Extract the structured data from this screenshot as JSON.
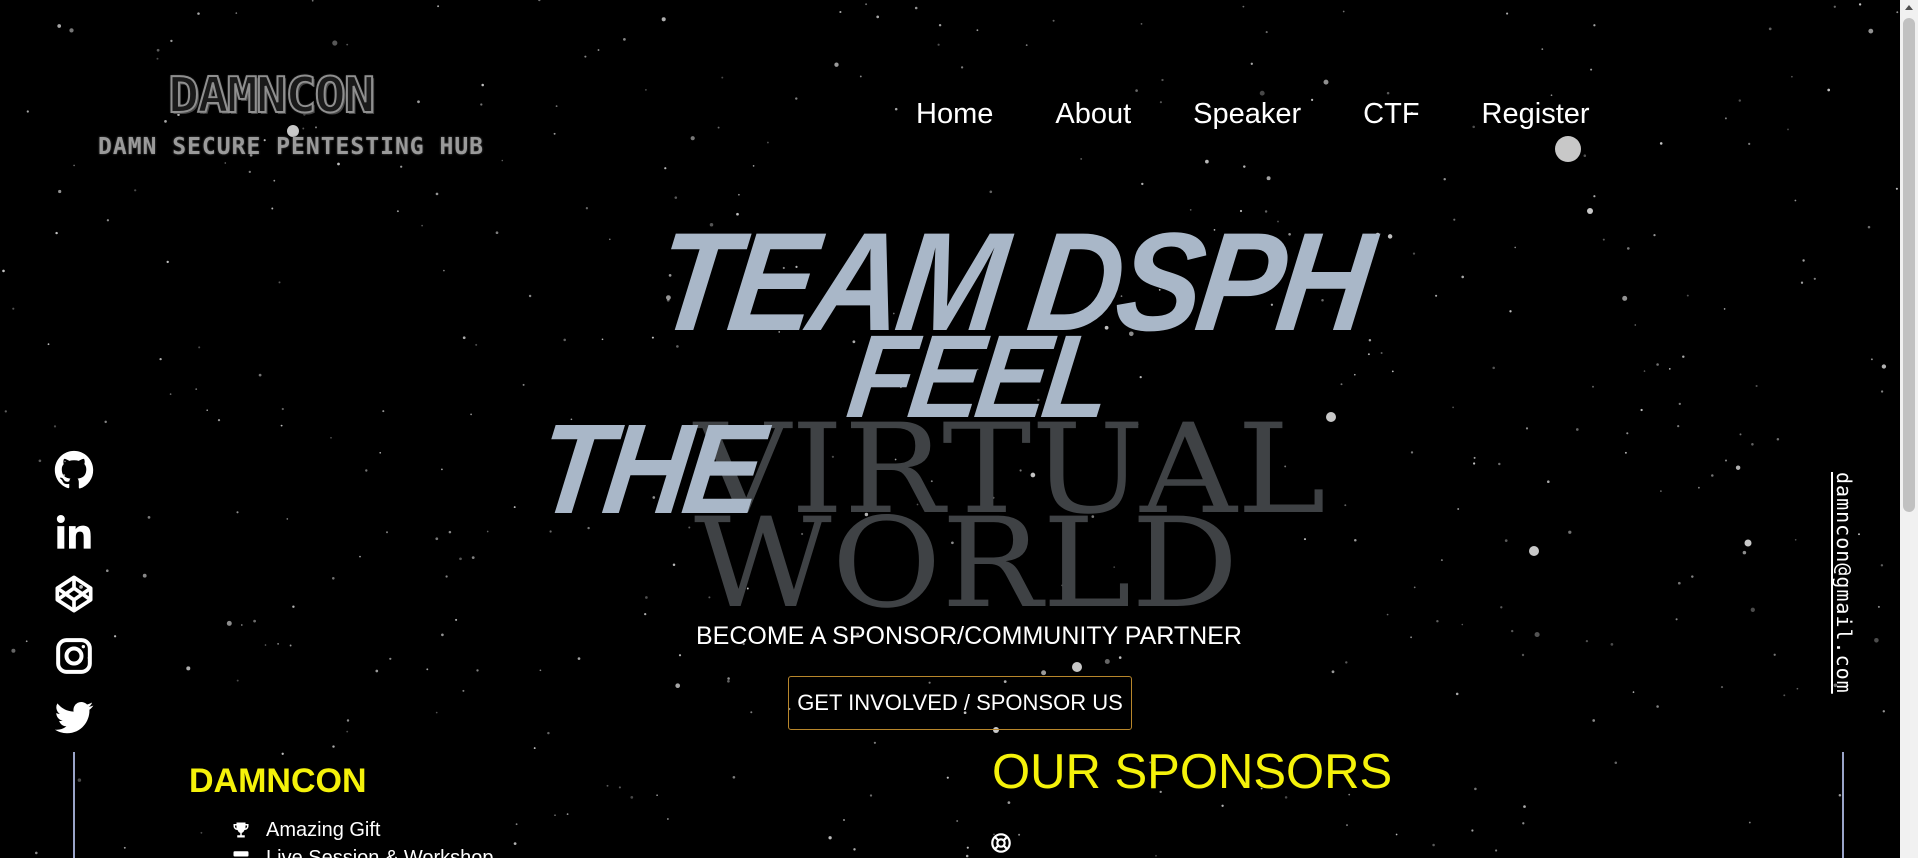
{
  "logo": {
    "title": "DAMNCON",
    "subtitle": "DAMN SECURE PENTESTING HUB"
  },
  "nav": {
    "items": [
      "Home",
      "About",
      "Speaker",
      "CTF",
      "Register"
    ]
  },
  "hero": {
    "line1": "TEAM DSPH",
    "line2": "FEEL",
    "line3": "THE",
    "virtual": "VIRTUAL",
    "world": "WORLD",
    "sponsor_text": "BECOME A SPONSOR/COMMUNITY PARTNER",
    "cta_label": "GET INVOLVED / SPONSOR US"
  },
  "social": {
    "icons": [
      "github-icon",
      "linkedin-icon",
      "codepen-icon",
      "instagram-icon",
      "twitter-icon"
    ]
  },
  "email": "damncon@gmail.com",
  "damncon_section": {
    "title": "DAMNCON",
    "features": [
      {
        "icon": "trophy-icon",
        "label": "Amazing Gift"
      },
      {
        "icon": "server-icon",
        "label": "Live Session & Workshop"
      }
    ]
  },
  "sponsors_section": {
    "title": "OUR SPONSORS",
    "icon": "lifebuoy-icon"
  },
  "colors": {
    "background": "#000000",
    "hero_italic": "#a9b7c8",
    "hero_serif": "#3f4245",
    "accent_yellow": "#f5f20a",
    "cta_border": "#b8862b"
  }
}
